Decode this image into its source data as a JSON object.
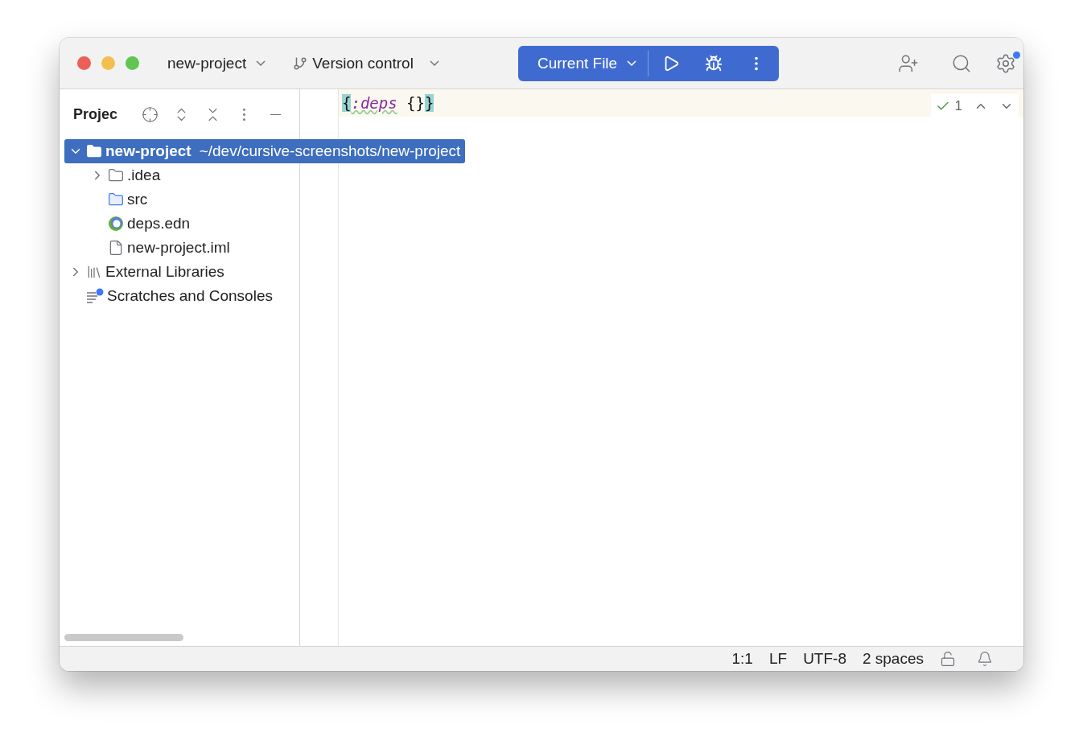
{
  "toolbar": {
    "project": "new-project",
    "vcs": "Version control",
    "run_config": "Current File"
  },
  "project_panel": {
    "title": "Projec",
    "tree": [
      {
        "label": "new-project",
        "path": "~/dev/cursive-screenshots/new-project",
        "kind": "module",
        "selected": true,
        "expanded": true,
        "children": [
          {
            "label": ".idea",
            "kind": "folder",
            "selected": false,
            "expanded": false
          },
          {
            "label": "src",
            "kind": "source-folder",
            "selected": false
          },
          {
            "label": "deps.edn",
            "kind": "clojure",
            "selected": false
          },
          {
            "label": "new-project.iml",
            "kind": "file",
            "selected": false
          }
        ]
      },
      {
        "label": "External Libraries",
        "kind": "library",
        "selected": false,
        "expanded": false
      },
      {
        "label": "Scratches and Consoles",
        "kind": "scratches",
        "selected": false
      }
    ]
  },
  "editor": {
    "tokens": [
      {
        "text": "{",
        "kind": "matched-brace"
      },
      {
        "text": ":deps",
        "kind": "keyword"
      },
      {
        "text": " {}",
        "kind": "plain"
      },
      {
        "text": "}",
        "kind": "matched-brace"
      }
    ],
    "inspections": "1"
  },
  "status_bar": [
    "1:1",
    "LF",
    "UTF-8",
    "2 spaces"
  ]
}
